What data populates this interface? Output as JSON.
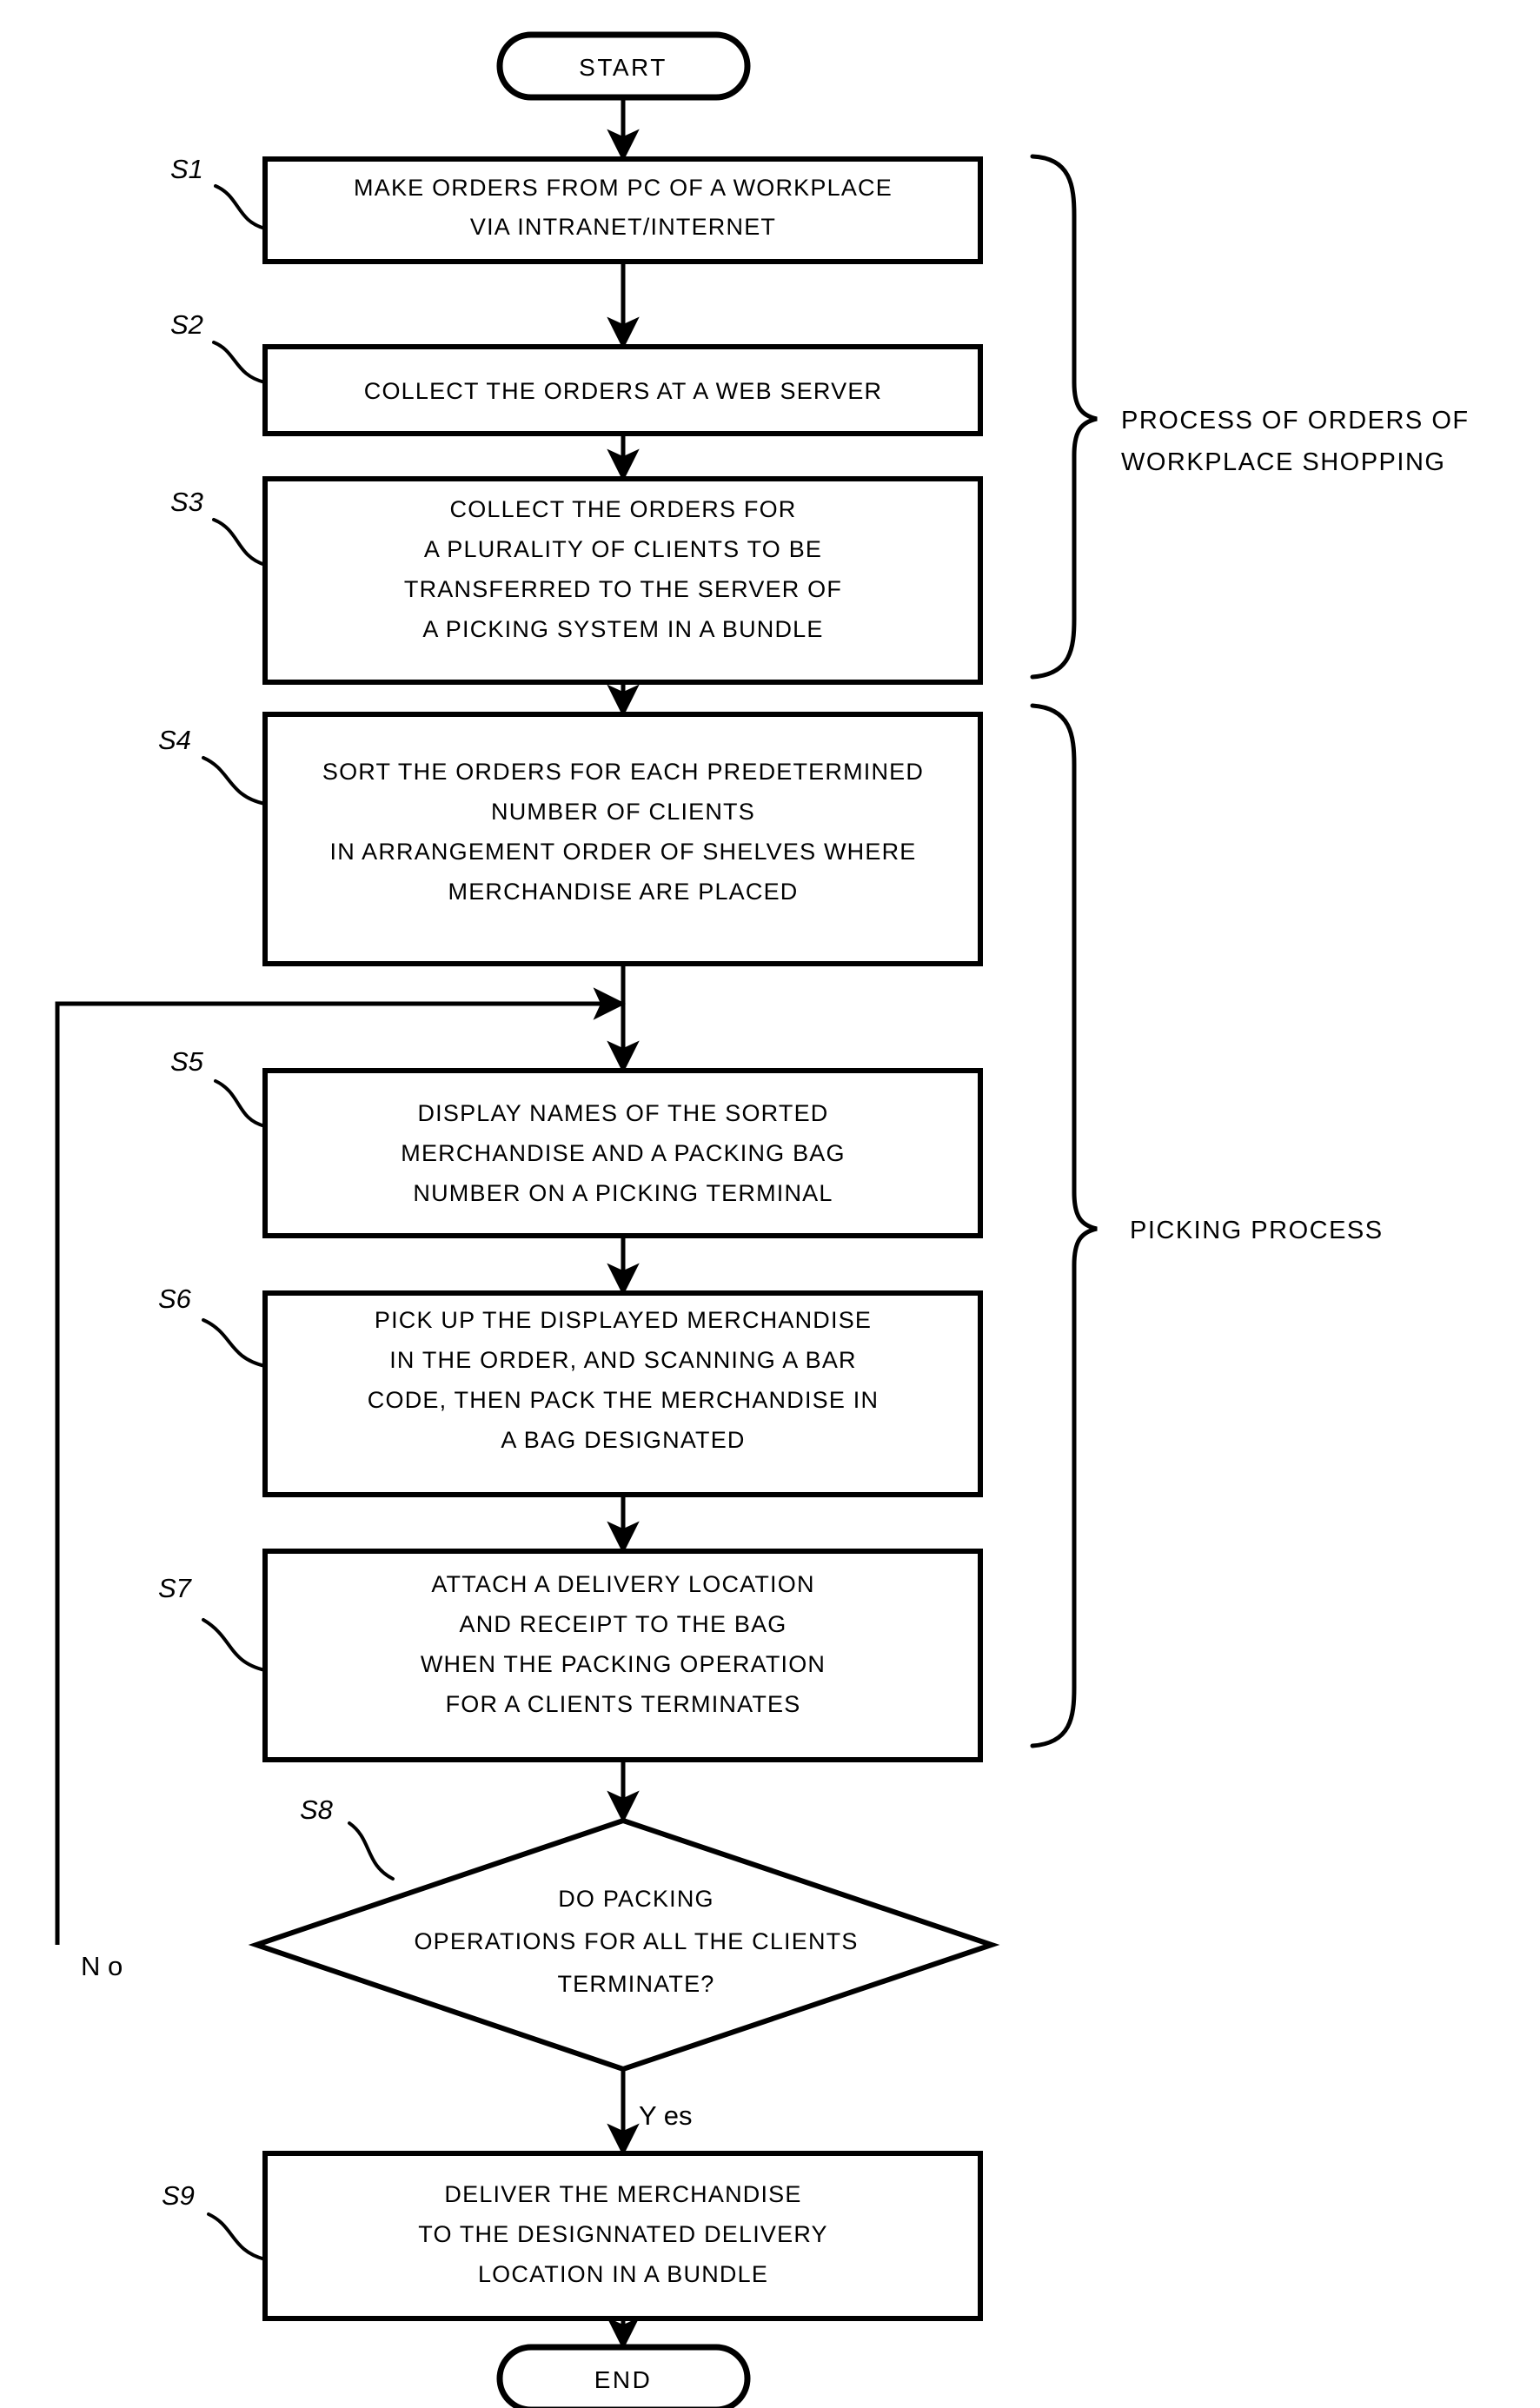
{
  "diagram": {
    "type": "flowchart",
    "title_visible": false,
    "ink_color": "#000000",
    "background_color": "#ffffff"
  },
  "nodes": {
    "start": {
      "label": "START",
      "shape": "terminal"
    },
    "end": {
      "label": "END",
      "shape": "terminal"
    },
    "s1": {
      "step": "S1",
      "lines": [
        "MAKE ORDERS FROM PC OF A WORKPLACE",
        "VIA INTRANET/INTERNET"
      ]
    },
    "s2": {
      "step": "S2",
      "lines": [
        "COLLECT THE ORDERS AT A WEB SERVER"
      ]
    },
    "s3": {
      "step": "S3",
      "lines": [
        "COLLECT THE ORDERS FOR",
        "A PLURALITY OF CLIENTS TO BE",
        "TRANSFERRED TO THE SERVER OF",
        "A PICKING SYSTEM IN A BUNDLE"
      ]
    },
    "s4": {
      "step": "S4",
      "lines": [
        "SORT THE ORDERS FOR EACH PREDETERMINED",
        "NUMBER OF CLIENTS",
        "IN ARRANGEMENT ORDER OF SHELVES WHERE",
        "MERCHANDISE ARE PLACED"
      ]
    },
    "s5": {
      "step": "S5",
      "lines": [
        "DISPLAY NAMES OF THE SORTED",
        "MERCHANDISE AND A PACKING BAG",
        "NUMBER ON A PICKING TERMINAL"
      ]
    },
    "s6": {
      "step": "S6",
      "lines": [
        "PICK UP THE DISPLAYED MERCHANDISE",
        "IN THE ORDER, AND SCANNING A BAR",
        "CODE, THEN PACK THE MERCHANDISE IN",
        "A BAG DESIGNATED"
      ]
    },
    "s7": {
      "step": "S7",
      "lines": [
        "ATTACH A DELIVERY LOCATION",
        "AND RECEIPT TO THE BAG",
        "WHEN THE PACKING OPERATION",
        "FOR A CLIENTS TERMINATES"
      ]
    },
    "s8": {
      "step": "S8",
      "shape": "decision",
      "lines": [
        "DO PACKING",
        "OPERATIONS FOR ALL THE CLIENTS",
        "TERMINATE?"
      ]
    },
    "s9": {
      "step": "S9",
      "lines": [
        "DELIVER THE MERCHANDISE",
        "TO THE DESIGNNATED DELIVERY",
        "LOCATION IN A BUNDLE"
      ]
    }
  },
  "branches": {
    "no_label": "N o",
    "yes_label": "Y es"
  },
  "groups": [
    {
      "id": "orders-group",
      "lines": [
        "PROCESS OF ORDERS OF",
        "WORKPLACE SHOPPING"
      ]
    },
    {
      "id": "picking-group",
      "lines": [
        "PICKING PROCESS"
      ]
    }
  ]
}
